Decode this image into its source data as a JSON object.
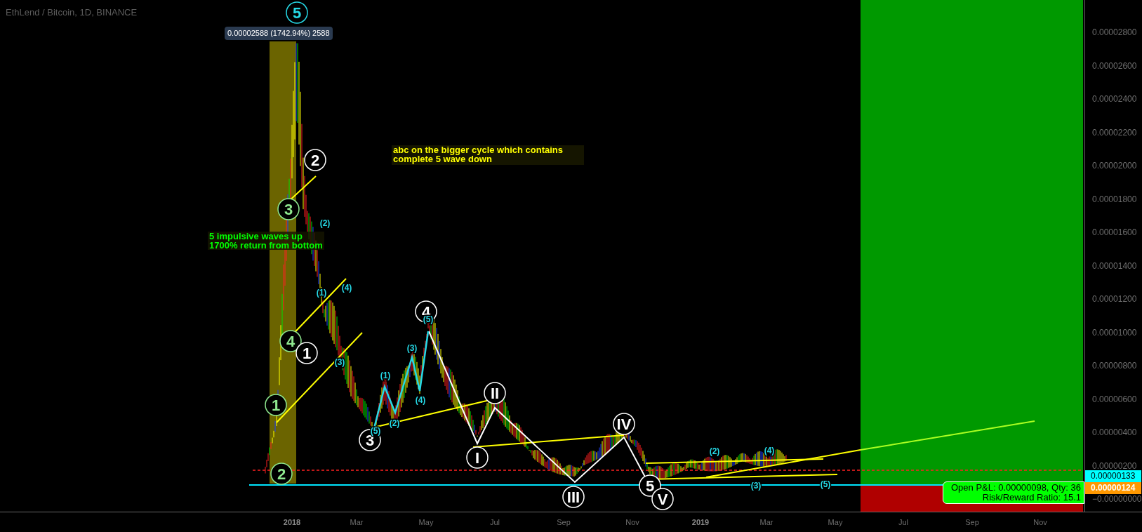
{
  "chart": {
    "title": "EthLend / Bitcoin, 1D, BINANCE",
    "peak_tag": "0.00002588 (1742.94%) 2588",
    "notes": [
      {
        "lines": [
          "5 impulsive waves up",
          "1700% return from bottom"
        ],
        "color": "#00ff00"
      },
      {
        "lines": [
          "abc on the bigger cycle which contains",
          "complete 5 wave down"
        ],
        "color": "#ffff00"
      }
    ],
    "wave_labels": [
      {
        "text": "5",
        "kind": "circle",
        "color": "#26d9e6"
      },
      {
        "text": "2",
        "kind": "circle",
        "color": "#ffffff"
      },
      {
        "text": "3",
        "kind": "circle",
        "color": "#8fe88f"
      },
      {
        "text": "4",
        "kind": "circle",
        "color": "#8fe88f"
      },
      {
        "text": "1",
        "kind": "circle",
        "color": "#ffffff"
      },
      {
        "text": "1",
        "kind": "circle",
        "color": "#8fe88f"
      },
      {
        "text": "2",
        "kind": "circle",
        "color": "#8fe88f"
      },
      {
        "text": "4",
        "kind": "circle",
        "color": "#ffffff"
      },
      {
        "text": "3",
        "kind": "circle",
        "color": "#ffffff"
      },
      {
        "text": "II",
        "kind": "circle",
        "color": "#ffffff"
      },
      {
        "text": "I",
        "kind": "circle",
        "color": "#ffffff"
      },
      {
        "text": "IV",
        "kind": "circle",
        "color": "#ffffff"
      },
      {
        "text": "III",
        "kind": "circle",
        "color": "#ffffff"
      },
      {
        "text": "5",
        "kind": "circle",
        "color": "#ffffff"
      },
      {
        "text": "V",
        "kind": "circle",
        "color": "#ffffff"
      },
      {
        "text": "(2)",
        "kind": "plain",
        "color": "#26d9e6"
      },
      {
        "text": "(1)",
        "kind": "plain",
        "color": "#26d9e6"
      },
      {
        "text": "(4)",
        "kind": "plain",
        "color": "#26d9e6"
      },
      {
        "text": "(3)",
        "kind": "plain",
        "color": "#26d9e6"
      },
      {
        "text": "(5)",
        "kind": "plain",
        "color": "#26d9e6"
      },
      {
        "text": "(3)",
        "kind": "plain",
        "color": "#26d9e6"
      },
      {
        "text": "(1)",
        "kind": "plain",
        "color": "#26d9e6"
      },
      {
        "text": "(4)",
        "kind": "plain",
        "color": "#26d9e6"
      },
      {
        "text": "(2)",
        "kind": "plain",
        "color": "#26d9e6"
      },
      {
        "text": "(5)",
        "kind": "plain",
        "color": "#26d9e6"
      },
      {
        "text": "(2)",
        "kind": "plain",
        "color": "#26d9e6"
      },
      {
        "text": "(4)",
        "kind": "plain",
        "color": "#26d9e6"
      },
      {
        "text": "(3)",
        "kind": "plain",
        "color": "#26d9e6"
      },
      {
        "text": "(5)",
        "kind": "plain",
        "color": "#26d9e6"
      }
    ],
    "position_box": {
      "lines": [
        "Open P&L: 0.00000098, Qty: 36",
        "Risk/Reward Ratio: 15.1"
      ]
    }
  },
  "price_axis": {
    "ticks": [
      "0.00002800",
      "0.00002600",
      "0.00002400",
      "0.00002200",
      "0.00002000",
      "0.00001800",
      "0.00001600",
      "0.00001400",
      "0.00001200",
      "0.00001000",
      "0.00000800",
      "0.00000600",
      "0.00000400",
      "0.00000200",
      "−0.00000000"
    ],
    "markers": [
      {
        "text": "0.00000133",
        "color": "#00ffff"
      },
      {
        "text": "0.00000124",
        "color": "#ff9800"
      }
    ]
  },
  "time_axis": {
    "ticks": [
      {
        "label": "2018",
        "kind": "year"
      },
      {
        "label": "Mar",
        "kind": "month"
      },
      {
        "label": "May",
        "kind": "month"
      },
      {
        "label": "Jul",
        "kind": "month"
      },
      {
        "label": "Sep",
        "kind": "month"
      },
      {
        "label": "Nov",
        "kind": "month"
      },
      {
        "label": "2019",
        "kind": "year"
      },
      {
        "label": "Mar",
        "kind": "month"
      },
      {
        "label": "May",
        "kind": "month"
      },
      {
        "label": "Jul",
        "kind": "month"
      },
      {
        "label": "Sep",
        "kind": "month"
      },
      {
        "label": "Nov",
        "kind": "month"
      }
    ]
  }
}
